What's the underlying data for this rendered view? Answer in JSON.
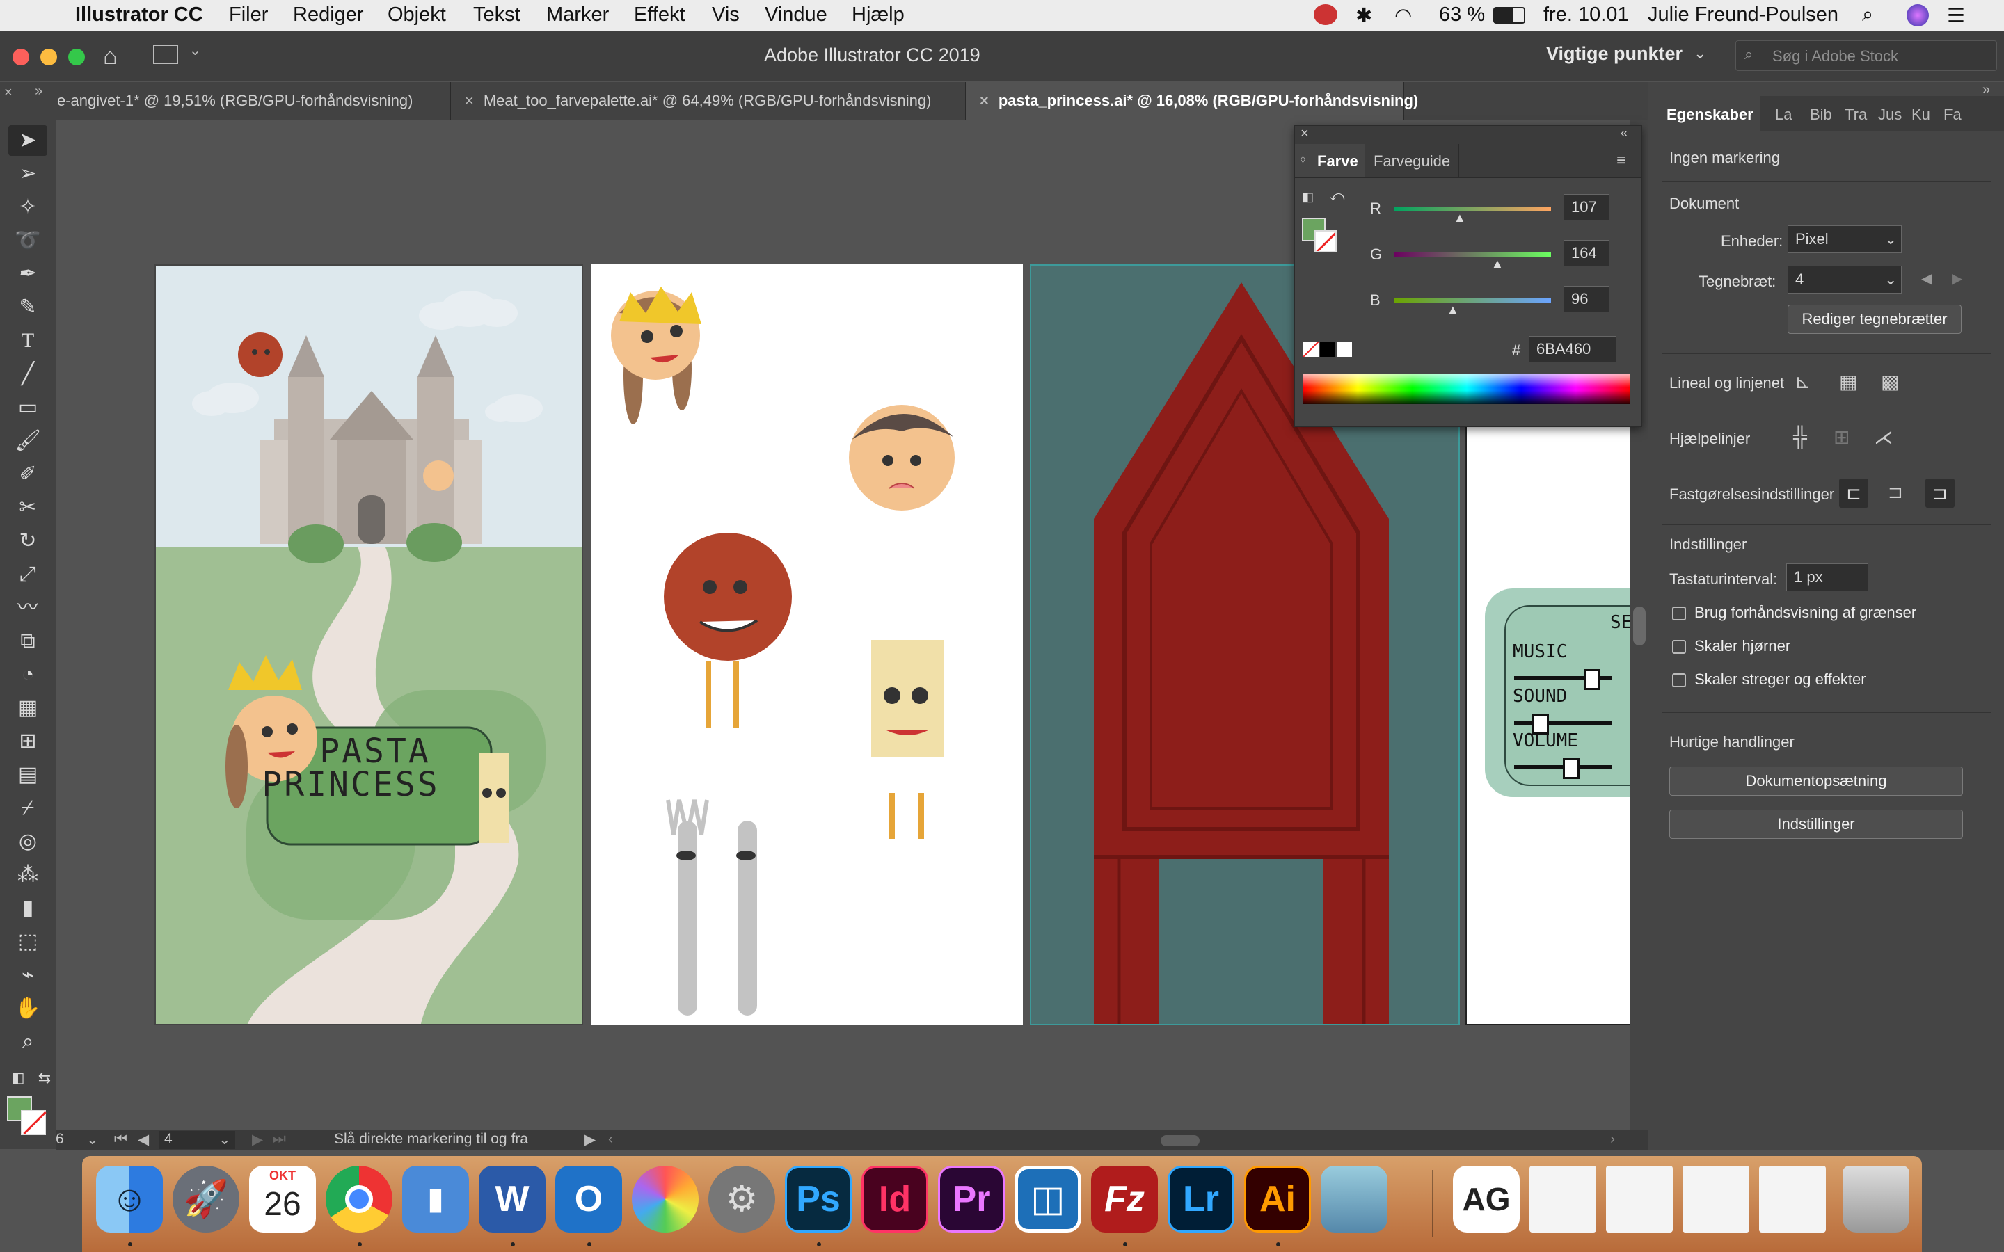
{
  "menubar": {
    "app_name": "Illustrator CC",
    "menus": [
      "Filer",
      "Rediger",
      "Objekt",
      "Tekst",
      "Marker",
      "Effekt",
      "Vis",
      "Vindue",
      "Hjælp"
    ],
    "battery": "63 %",
    "datetime": "fre. 10.01",
    "user": "Julie Freund-Poulsen"
  },
  "titlebar": {
    "title": "Adobe Illustrator CC 2019",
    "workspace": "Vigtige punkter",
    "search_placeholder": "Søg i Adobe Stock"
  },
  "tabs": [
    {
      "label": "e-angivet-1* @ 19,51% (RGB/GPU-forhåndsvisning)"
    },
    {
      "label": "Meat_too_farvepalette.ai* @ 64,49% (RGB/GPU-forhåndsvisning)"
    },
    {
      "label": "pasta_princess.ai* @ 16,08% (RGB/GPU-forhåndsvisning)"
    }
  ],
  "artwork": {
    "title_line1": "PASTA",
    "title_line2": "PRINCESS",
    "settings_title": "SETT",
    "settings_items": [
      "MUSIC",
      "SOUND",
      "VOLUME"
    ]
  },
  "color_panel": {
    "tab_color": "Farve",
    "tab_guide": "Farveguide",
    "r_label": "R",
    "g_label": "G",
    "b_label": "B",
    "r": 107,
    "g": 164,
    "b": 96,
    "hash": "#",
    "hex": "6BA460",
    "fill_color": "#6BA460"
  },
  "properties": {
    "tabs": [
      "Egenskaber",
      "La",
      "Bib",
      "Tra",
      "Jus",
      "Ku",
      "Fa"
    ],
    "no_selection": "Ingen markering",
    "document_section": "Dokument",
    "units_label": "Enheder:",
    "units_value": "Pixel",
    "artboard_label": "Tegnebræt:",
    "artboard_value": "4",
    "edit_artboards": "Rediger tegnebrætter",
    "rulers_grid": "Lineal og linjenet",
    "guides": "Hjælpelinjer",
    "snap_options": "Fastgørelsesindstillinger",
    "preferences_section": "Indstillinger",
    "keyboard_increment_label": "Tastaturinterval:",
    "keyboard_increment_value": "1 px",
    "checkboxes": [
      "Brug forhåndsvisning af grænser",
      "Skaler hjørner",
      "Skaler streger og effekter"
    ],
    "quick_actions": "Hurtige handlinger",
    "doc_setup_button": "Dokumentopsætning",
    "preferences_button": "Indstillinger"
  },
  "statusbar": {
    "zoom": "6",
    "artboard_num": "4",
    "status_text": "Slå direkte markering til og fra"
  },
  "dock": {
    "icons": [
      "finder-icon",
      "launchpad-icon",
      "calendar-icon",
      "chrome-icon",
      "keynote-icon",
      "word-icon",
      "outlook-icon",
      "photos-icon",
      "system-preferences-icon",
      "photoshop-icon",
      "indesign-icon",
      "premiere-icon",
      "unknown-app-icon",
      "filezilla-icon",
      "lightroom-icon",
      "illustrator-icon",
      "preview-icon"
    ],
    "calendar_month": "OKT",
    "calendar_day": "26",
    "ps_label": "Ps",
    "id_label": "Id",
    "pr_label": "Pr",
    "lr_label": "Lr",
    "ai_label": "Ai",
    "fz_label": "Fz",
    "w_label": "W",
    "o_label": "O",
    "ag_label": "AG"
  }
}
